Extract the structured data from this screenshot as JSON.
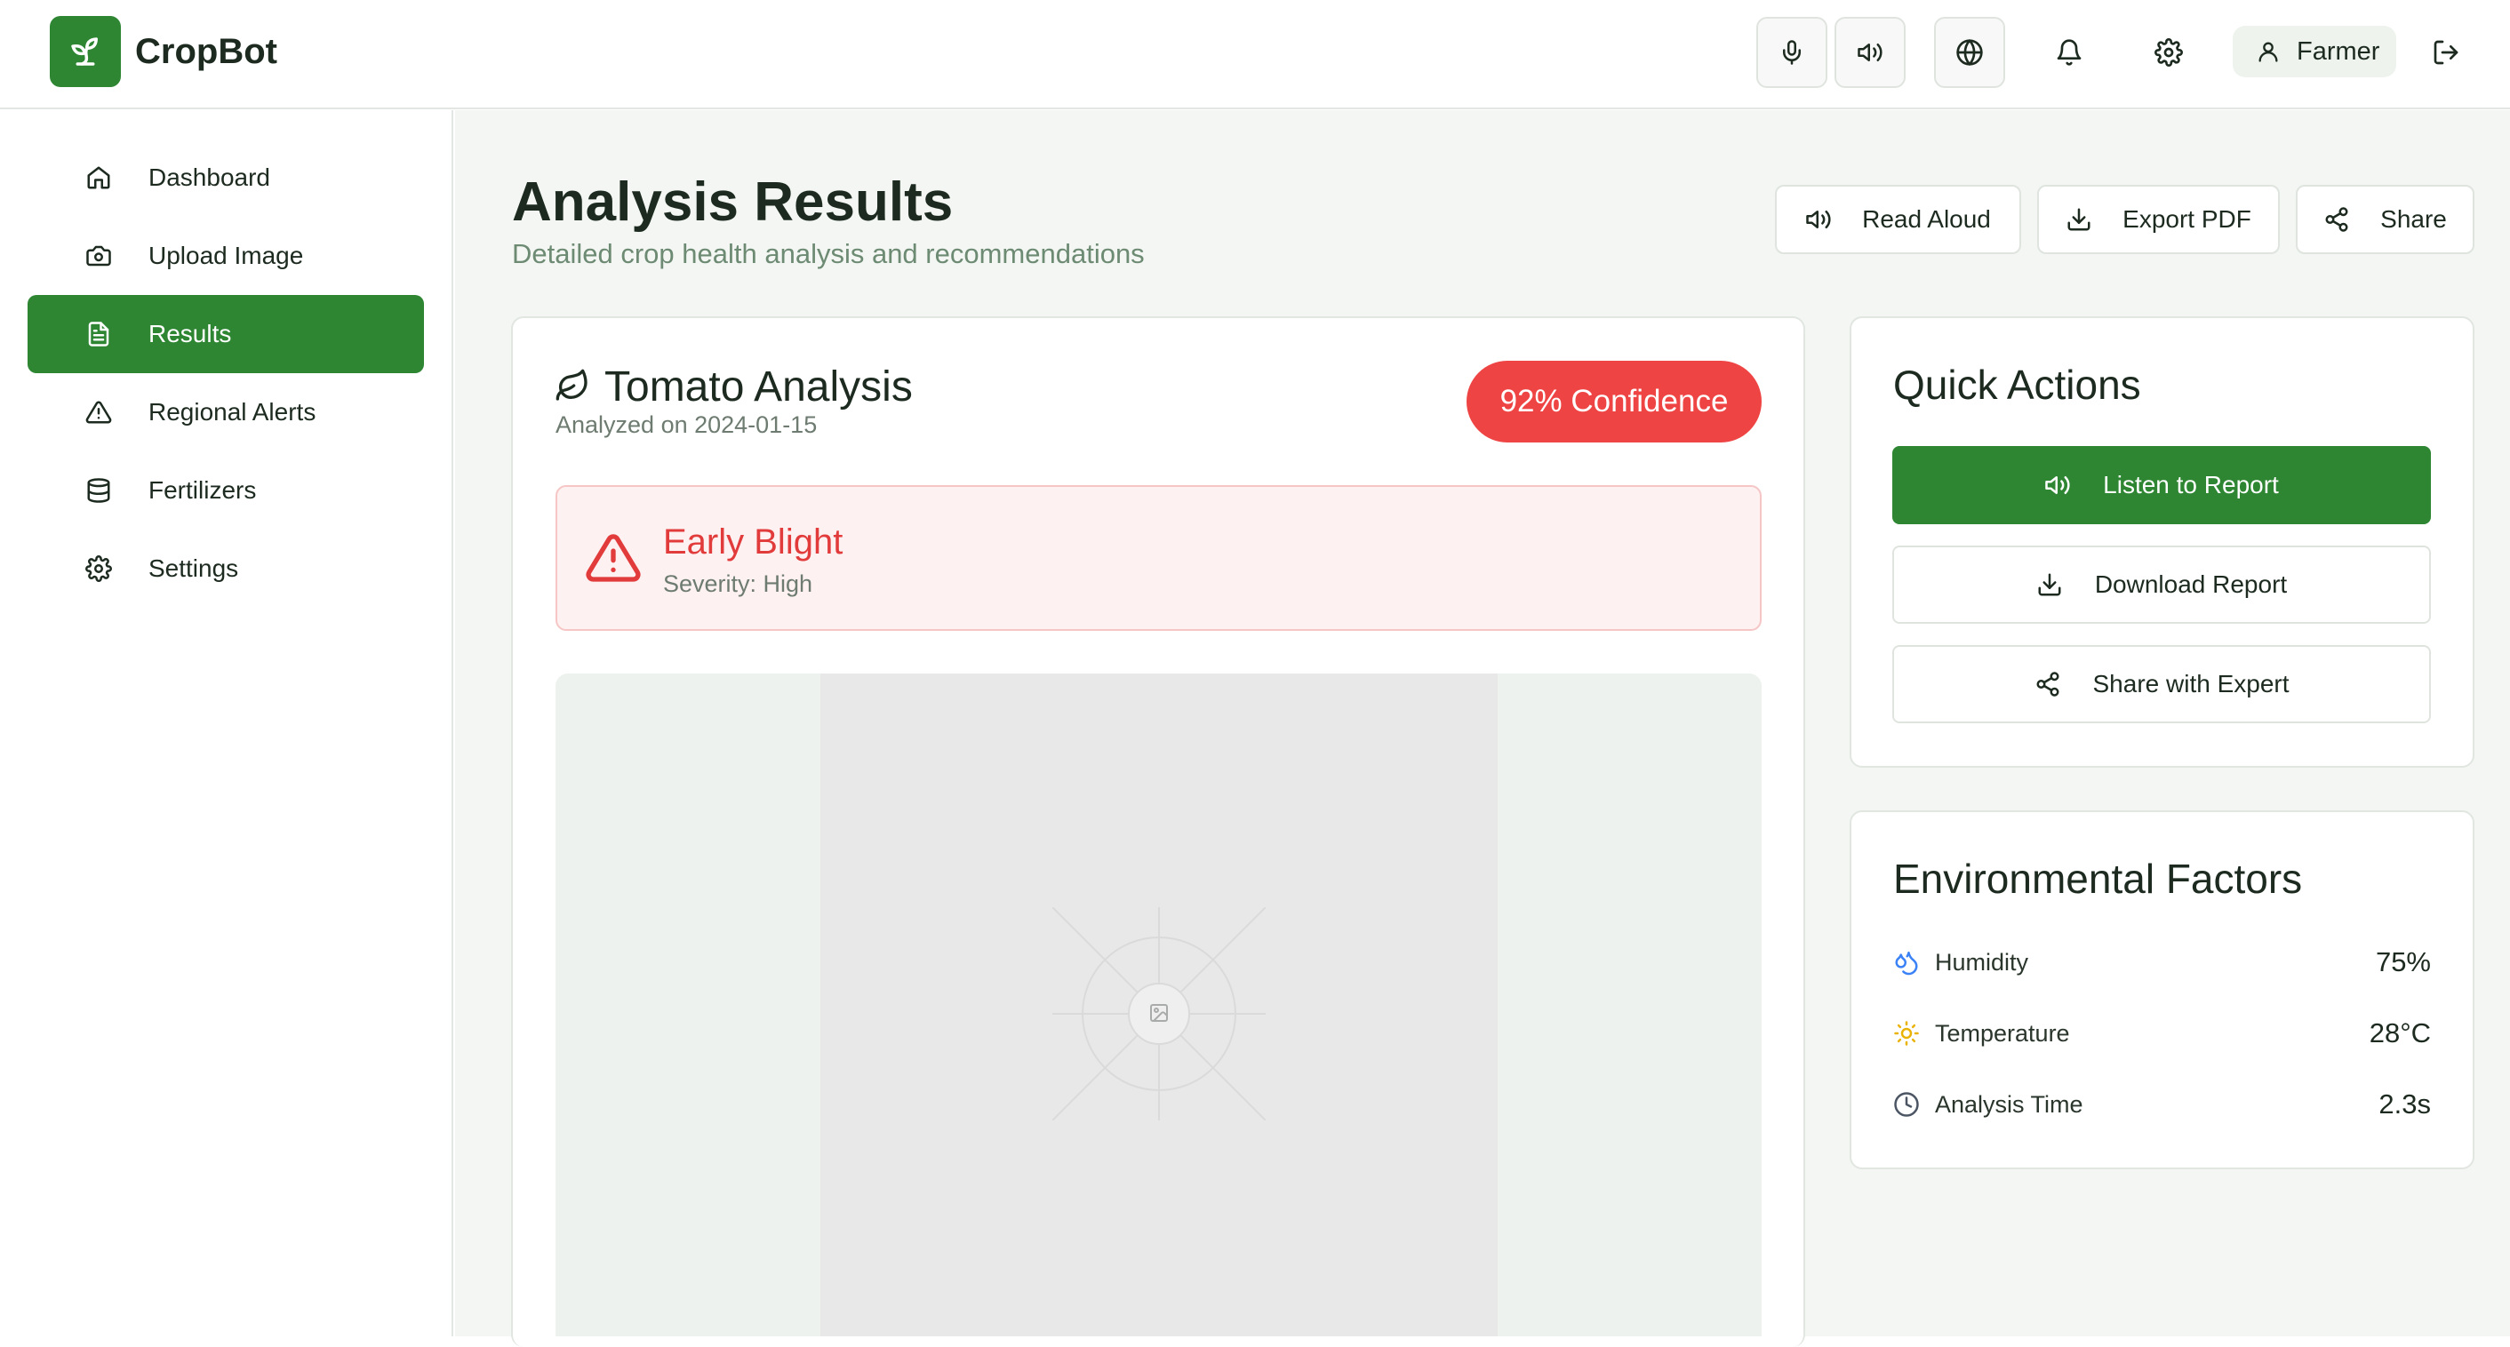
{
  "app": {
    "name": "CropBot"
  },
  "header": {
    "user_label": "Farmer"
  },
  "sidebar": {
    "items": [
      {
        "label": "Dashboard",
        "icon": "home-icon"
      },
      {
        "label": "Upload Image",
        "icon": "camera-icon"
      },
      {
        "label": "Results",
        "icon": "document-icon",
        "active": true
      },
      {
        "label": "Regional Alerts",
        "icon": "alert-triangle-icon"
      },
      {
        "label": "Fertilizers",
        "icon": "database-icon"
      },
      {
        "label": "Settings",
        "icon": "gear-icon"
      }
    ]
  },
  "page": {
    "title": "Analysis Results",
    "subtitle": "Detailed crop health analysis and recommendations",
    "toolbar": {
      "read_aloud": "Read Aloud",
      "export_pdf": "Export PDF",
      "share": "Share"
    }
  },
  "analysis": {
    "title": "Tomato Analysis",
    "date": "Analyzed on 2024-01-15",
    "confidence": "92% Confidence",
    "disease": {
      "name": "Early Blight",
      "severity": "Severity: High"
    }
  },
  "quick_actions": {
    "title": "Quick Actions",
    "listen": "Listen to Report",
    "download": "Download Report",
    "share_expert": "Share with Expert"
  },
  "environment": {
    "title": "Environmental Factors",
    "rows": [
      {
        "label": "Humidity",
        "value": "75%",
        "icon": "droplets-icon"
      },
      {
        "label": "Temperature",
        "value": "28°C",
        "icon": "sun-icon"
      },
      {
        "label": "Analysis Time",
        "value": "2.3s",
        "icon": "clock-icon"
      }
    ]
  },
  "colors": {
    "brand": "#2e8633",
    "danger": "#ef4444",
    "background": "#f3f6f3"
  }
}
